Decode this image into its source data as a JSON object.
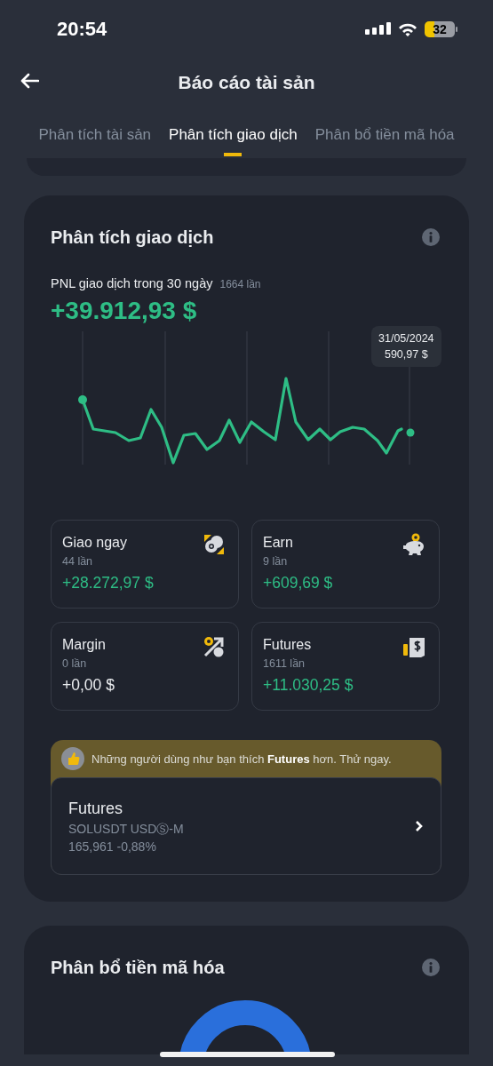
{
  "status_bar": {
    "time": "20:54",
    "battery": "32"
  },
  "header": {
    "title": "Báo cáo tài sản"
  },
  "tabs": [
    {
      "label": "Phân tích tài sản",
      "selected": false
    },
    {
      "label": "Phân tích giao dịch",
      "selected": true
    },
    {
      "label": "Phân bổ tiền mã hóa",
      "selected": false
    }
  ],
  "trade_analysis": {
    "title": "Phân tích giao dịch",
    "pnl_label": "PNL giao dịch trong 30 ngày",
    "trade_count": "1664 lần",
    "pnl_value": "+39.912,93 $",
    "tooltip": {
      "date": "31/05/2024",
      "value": "590,97 $"
    },
    "tiles": [
      {
        "kind": "spot",
        "name": "Giao ngay",
        "count": "44 lần",
        "value": "+28.272,97 $",
        "positive": true
      },
      {
        "kind": "earn",
        "name": "Earn",
        "count": "9 lần",
        "value": "+609,69 $",
        "positive": true
      },
      {
        "kind": "margin",
        "name": "Margin",
        "count": "0 lần",
        "value": "+0,00 $",
        "positive": false
      },
      {
        "kind": "futures",
        "name": "Futures",
        "count": "1611 lần",
        "value": "+11.030,25 $",
        "positive": true
      }
    ],
    "promo": {
      "message": "Những người dùng như bạn thích **Futures** hơn. Thử ngay.",
      "product": "Futures",
      "symbol": "SOLUSDT USDⓈ-M",
      "quote": "165,961 -0,88%"
    }
  },
  "allocation": {
    "title": "Phân bổ tiền mã hóa"
  }
}
